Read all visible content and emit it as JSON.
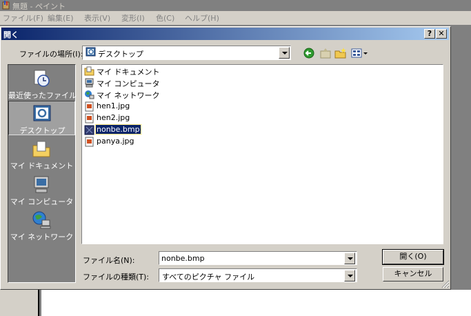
{
  "paint": {
    "title": "無題 - ペイント",
    "menu": [
      "ファイル(F)",
      "編集(E)",
      "表示(V)",
      "変形(I)",
      "色(C)",
      "ヘルプ(H)"
    ]
  },
  "dialog": {
    "title": "開く",
    "help_label": "?",
    "close_label": "✕",
    "lookin_label": "ファイルの場所(I):",
    "lookin_value": "デスクトップ",
    "places": [
      {
        "label": "最近使ったファイル",
        "icon": "recent-icon"
      },
      {
        "label": "デスクトップ",
        "icon": "desktop-icon"
      },
      {
        "label": "マイ ドキュメント",
        "icon": "my-documents-icon"
      },
      {
        "label": "マイ コンピュータ",
        "icon": "my-computer-icon"
      },
      {
        "label": "マイ ネットワーク",
        "icon": "my-network-icon"
      }
    ],
    "files": [
      {
        "name": "マイ ドキュメント",
        "icon": "folder-icon"
      },
      {
        "name": "マイ コンピュータ",
        "icon": "computer-icon"
      },
      {
        "name": "マイ ネットワーク",
        "icon": "network-icon"
      },
      {
        "name": "hen1.jpg",
        "icon": "jpg-icon"
      },
      {
        "name": "hen2.jpg",
        "icon": "jpg-icon"
      },
      {
        "name": "nonbe.bmp",
        "icon": "bmp-icon",
        "selected": true
      },
      {
        "name": "panya.jpg",
        "icon": "jpg-icon"
      }
    ],
    "filename_label": "ファイル名(N):",
    "filename_value": "nonbe.bmp",
    "filetype_label": "ファイルの種類(T):",
    "filetype_value": "すべてのピクチャ ファイル",
    "open_button": "開く(O)",
    "cancel_button": "キャンセル"
  },
  "colors": {
    "title_active_start": "#0a246a",
    "title_active_end": "#a6caf0",
    "face": "#d4d0c8",
    "places_bg": "#808080",
    "selection": "#0a246a"
  }
}
